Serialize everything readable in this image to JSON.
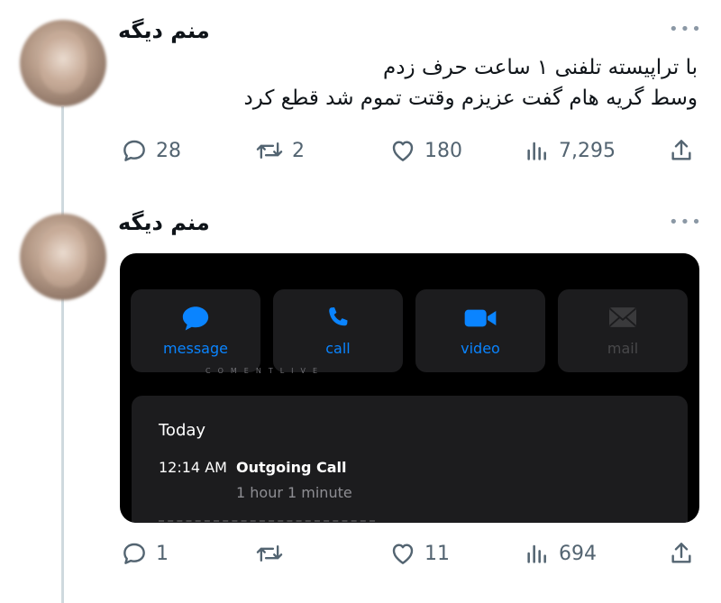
{
  "tweets": [
    {
      "author_name": "منم دیگه",
      "text_line1": "با تراپیسته تلفنی ۱ ساعت حرف زدم",
      "text_line2": "وسط گریه هام گفت عزیزم وقتت تموم شد قطع کرد",
      "replies": "28",
      "retweets": "2",
      "likes": "180",
      "views": "7,295"
    },
    {
      "author_name": "منم دیگه",
      "replies": "1",
      "retweets": "",
      "likes": "11",
      "views": "694",
      "media": {
        "actions": [
          {
            "label": "message",
            "icon": "message-bubble-icon",
            "color": "#0a84ff"
          },
          {
            "label": "call",
            "icon": "phone-icon",
            "color": "#0a84ff"
          },
          {
            "label": "video",
            "icon": "video-camera-icon",
            "color": "#0a84ff"
          },
          {
            "label": "mail",
            "icon": "envelope-icon",
            "color": "#3a3a3c"
          }
        ],
        "watermark": "COMENTLIVE",
        "history_day": "Today",
        "call_time": "12:14 AM",
        "call_type": "Outgoing Call",
        "call_duration": "1 hour 1 minute"
      }
    }
  ],
  "colors": {
    "action_gray": "#536471",
    "ios_blue": "#0a84ff",
    "thread_line": "#cfd9de"
  }
}
